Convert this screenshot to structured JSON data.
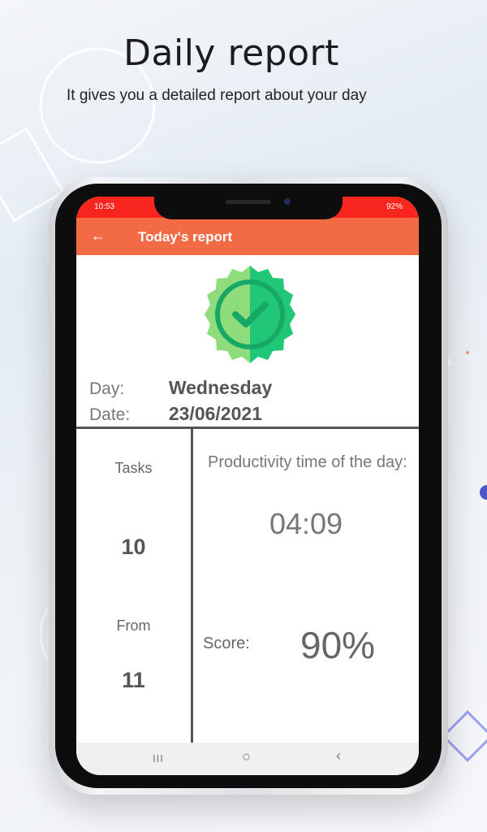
{
  "promo": {
    "title": "Daily report",
    "subtitle": "It gives you a detailed report about your day"
  },
  "status_bar": {
    "time": "10:53",
    "right": "92%"
  },
  "app_bar": {
    "back_icon": "arrow-left-icon",
    "title": "Today's report"
  },
  "badge": {
    "icon": "check-badge-icon",
    "colors": {
      "outer": "#8fdc7c",
      "outer_dark": "#1fc777",
      "ring": "#18a865",
      "check": "#18a865"
    }
  },
  "info": {
    "day_label": "Day:",
    "day_value": "Wednesday",
    "date_label": "Date:",
    "date_value": "23/06/2021"
  },
  "stats": {
    "tasks_label": "Tasks",
    "tasks_value": "10",
    "from_label": "From",
    "from_value": "11",
    "productivity_label": "Productivity time of the day:",
    "productivity_value": "04:09",
    "score_label": "Score:",
    "score_value": "90%"
  },
  "nav_bar": {
    "recents": "III",
    "home_icon": "home-circle-icon",
    "back_icon": "chevron-left-icon"
  },
  "colors": {
    "status_bar": "#f7251d",
    "app_bar": "#f26b44"
  }
}
